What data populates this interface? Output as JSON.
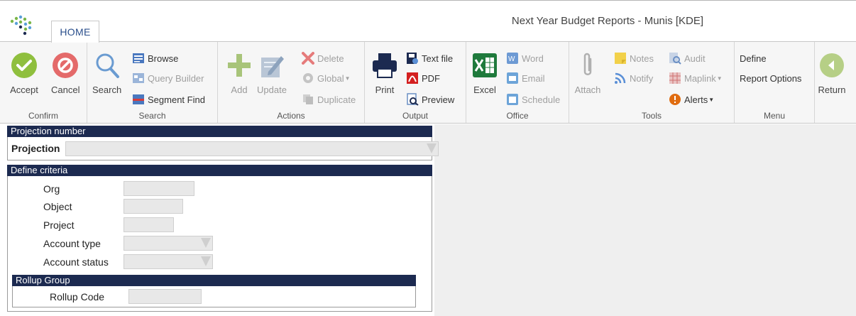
{
  "window": {
    "title": "Next Year Budget Reports - Munis [KDE]"
  },
  "tabs": {
    "home": "HOME"
  },
  "ribbon": {
    "confirm": {
      "label": "Confirm",
      "accept": "Accept",
      "cancel": "Cancel"
    },
    "search": {
      "label": "Search",
      "search": "Search",
      "browse": "Browse",
      "query_builder": "Query Builder",
      "segment_find": "Segment Find"
    },
    "actions": {
      "label": "Actions",
      "add": "Add",
      "update": "Update",
      "delete": "Delete",
      "global": "Global",
      "duplicate": "Duplicate"
    },
    "output": {
      "label": "Output",
      "print": "Print",
      "text_file": "Text file",
      "pdf": "PDF",
      "preview": "Preview"
    },
    "office": {
      "label": "Office",
      "excel": "Excel",
      "word": "Word",
      "email": "Email",
      "schedule": "Schedule"
    },
    "tools": {
      "label": "Tools",
      "attach": "Attach",
      "notes": "Notes",
      "notify": "Notify",
      "audit": "Audit",
      "maplink": "Maplink",
      "alerts": "Alerts"
    },
    "menu": {
      "label": "Menu",
      "define": "Define",
      "report_options": "Report Options",
      "return": "Return"
    }
  },
  "projection_panel": {
    "title": "Projection number",
    "projection_label": "Projection",
    "projection_value": ""
  },
  "criteria_panel": {
    "title": "Define criteria",
    "org": {
      "label": "Org",
      "value": ""
    },
    "object": {
      "label": "Object",
      "value": ""
    },
    "project": {
      "label": "Project",
      "value": ""
    },
    "account_type": {
      "label": "Account type",
      "value": ""
    },
    "account_status": {
      "label": "Account status",
      "value": ""
    }
  },
  "rollup_panel": {
    "title": "Rollup Group",
    "rollup_code": {
      "label": "Rollup Code",
      "value": ""
    }
  },
  "icons": [
    "munis-logo-icon",
    "check-icon",
    "cancel-icon",
    "search-icon",
    "browse-icon",
    "query-builder-icon",
    "segment-find-icon",
    "plus-icon",
    "edit-icon",
    "delete-x-icon",
    "global-icon",
    "duplicate-icon",
    "printer-icon",
    "text-file-icon",
    "pdf-icon",
    "preview-icon",
    "excel-icon",
    "word-icon",
    "email-icon",
    "schedule-icon",
    "paperclip-icon",
    "notes-icon",
    "notify-icon",
    "audit-icon",
    "maplink-icon",
    "alert-icon",
    "return-arrow-icon"
  ],
  "colors": {
    "accent": "#1c2a50",
    "accept": "#8fbf3e",
    "cancel": "#e46a6a",
    "excel": "#1f7a3c",
    "alert": "#e06c10"
  }
}
